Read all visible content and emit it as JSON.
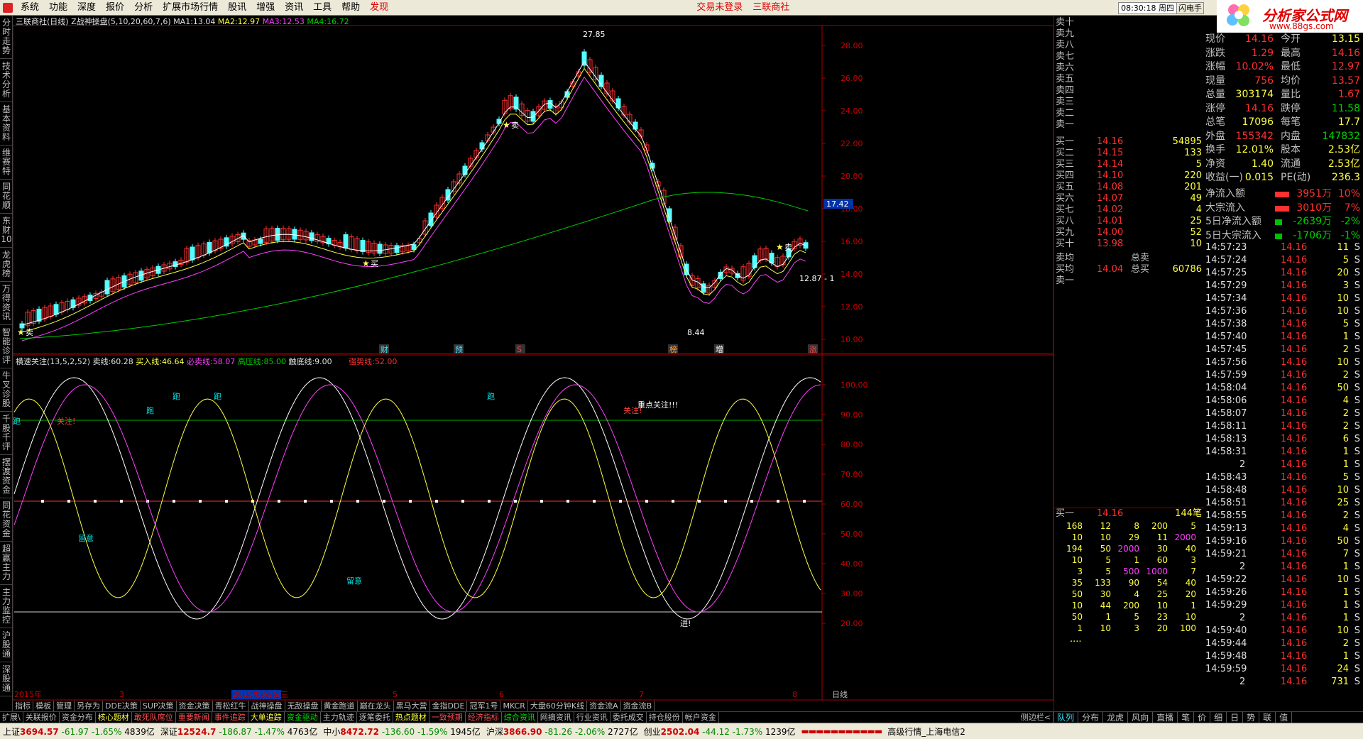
{
  "menu": {
    "items": [
      "系统",
      "功能",
      "深度",
      "报价",
      "分析",
      "扩展市场行情",
      "股讯",
      "增强",
      "资讯",
      "工具",
      "帮助"
    ],
    "alert": "发现",
    "trade_status": "交易未登录",
    "stock": "三联商社",
    "clock": "08:30:18 周四",
    "flash": "闪电手",
    "more": "行"
  },
  "brand": {
    "title": "分析家公式网",
    "url": "www.88gs.com"
  },
  "left_tabs": [
    "分时走势",
    "技术分析",
    "基本资料",
    "维赛特",
    "同花顺",
    "东财10",
    "龙虎榜",
    "万得资讯",
    "智能诊评",
    "牛叉诊股",
    "千股千评",
    "摆渡资金",
    "同花资金",
    "超赢主力",
    "主力监控",
    "沪股通",
    "深股通"
  ],
  "chart": {
    "header": {
      "stock": "三联商社(日线)",
      "indicator": "Z战神操盘(5,10,20,60,7,6)",
      "ma1_label": "MA1:",
      "ma1": "13.04",
      "ma2_label": "MA2:",
      "ma2": "12.97",
      "ma3_label": "MA3:",
      "ma3": "12.53",
      "ma4_label": "MA4:",
      "ma4": "16.72"
    },
    "price_axis": [
      "28.00",
      "26.00",
      "24.00",
      "22.00",
      "20.00",
      "18.00",
      "16.00",
      "14.00",
      "12.00",
      "10.00"
    ],
    "current_price": "17.42",
    "high_label": "27.85",
    "low_label": "8.44",
    "last_label": "12.87 - 1",
    "sell_marks": [
      "卖",
      "卖",
      "卖",
      "卖"
    ],
    "buy_mark": "买",
    "event_labels": [
      "财",
      "预",
      "S",
      "榜",
      "增",
      "涨"
    ],
    "sub_header": {
      "name": "横速关注(13,5,2,52)",
      "sell_label": "卖线:",
      "sell": "60.28",
      "buy_label": "买入线:",
      "buy": "46.64",
      "must_label": "必卖线:",
      "must": "58.07",
      "high_label": "高压线:",
      "high": "85.00",
      "bottom_label": "触底线:",
      "bottom": "9.00",
      "trend_label": "强势线:",
      "trend": "52.00"
    },
    "osc_axis": [
      "100.00",
      "90.00",
      "80.00",
      "70.00",
      "60.00",
      "50.00",
      "40.00",
      "30.00",
      "20.00"
    ],
    "osc_notes": {
      "run": "跑",
      "focus": "关注!",
      "key_focus": "重点关注!!!",
      "attention": "留意",
      "enter": "进!"
    },
    "date_labels": [
      "2015年",
      "3",
      "2015/03/25/三",
      "5",
      "6",
      "7",
      "8"
    ],
    "period": "日线"
  },
  "tab_row1": [
    "指标",
    "模板",
    "管理",
    "另存为",
    "DDE决策",
    "SUP决策",
    "资金决策",
    "青松红牛",
    "战神操盘",
    "无敌操盘",
    "黄金跑道",
    "巅在龙头",
    "黑马大营",
    "金指DDE",
    "冠军1号",
    "MKCR",
    "大盘60分钟K线",
    "资金流A",
    "资金流B"
  ],
  "tab_row2": [
    "扩展\\",
    "关联报价",
    "资金分布",
    "核心题材",
    "敢死队席位",
    "重要新闻",
    "事件追踪",
    "大单追踪",
    "资金驱动",
    "主力轨迹",
    "逐笔委托",
    "热点题材",
    "一致预期",
    "经济指标",
    "综合资讯",
    "网摘资讯",
    "行业资讯",
    "委托成交",
    "持仓股份",
    "帐户资金"
  ],
  "side_tag": "侧边栏<",
  "right_tabs": [
    "队列",
    "分布",
    "龙虎",
    "风向",
    "直播",
    "笔",
    "价",
    "细",
    "日",
    "势",
    "联",
    "值"
  ],
  "order_book": {
    "sells": [
      {
        "l": "卖十"
      },
      {
        "l": "卖九"
      },
      {
        "l": "卖八"
      },
      {
        "l": "卖七"
      },
      {
        "l": "卖六"
      },
      {
        "l": "卖五"
      },
      {
        "l": "卖四"
      },
      {
        "l": "卖三"
      },
      {
        "l": "卖二"
      },
      {
        "l": "卖一"
      }
    ],
    "buys": [
      {
        "l": "买一",
        "p": "14.16",
        "v": "54895"
      },
      {
        "l": "买二",
        "p": "14.15",
        "v": "133"
      },
      {
        "l": "买三",
        "p": "14.14",
        "v": "5"
      },
      {
        "l": "买四",
        "p": "14.10",
        "v": "220"
      },
      {
        "l": "买五",
        "p": "14.08",
        "v": "201"
      },
      {
        "l": "买六",
        "p": "14.07",
        "v": "49"
      },
      {
        "l": "买七",
        "p": "14.02",
        "v": "4"
      },
      {
        "l": "买八",
        "p": "14.01",
        "v": "25"
      },
      {
        "l": "买九",
        "p": "14.00",
        "v": "52"
      },
      {
        "l": "买十",
        "p": "13.98",
        "v": "10"
      }
    ],
    "sell_avg_label": "卖均",
    "total_sell_label": "总卖",
    "buy_avg_label": "买均",
    "buy_avg": "14.04",
    "total_buy_label": "总买",
    "total_buy": "60786",
    "sell_one_label": "卖一",
    "queue_label": "买一",
    "queue_price": "14.16",
    "queue_count": "144笔",
    "queue": [
      [
        "168",
        "12",
        "8",
        "200",
        "5"
      ],
      [
        "10",
        "10",
        "29",
        "11",
        "2000"
      ],
      [
        "194",
        "50",
        "2000",
        "30",
        "40"
      ],
      [
        "10",
        "5",
        "1",
        "60",
        "3"
      ],
      [
        "3",
        "5",
        "500",
        "1000",
        "7"
      ],
      [
        "35",
        "133",
        "90",
        "54",
        "40"
      ],
      [
        "50",
        "30",
        "4",
        "25",
        "20"
      ],
      [
        "10",
        "44",
        "200",
        "10",
        "1"
      ],
      [
        "50",
        "1",
        "5",
        "23",
        "10"
      ],
      [
        "1",
        "10",
        "3",
        "20",
        "100"
      ]
    ],
    "queue_more": "...."
  },
  "stats": [
    {
      "a": "现价",
      "av": "14.16",
      "b": "今开",
      "bv": "13.15"
    },
    {
      "a": "涨跌",
      "av": "1.29",
      "b": "最高",
      "bv": "14.16"
    },
    {
      "a": "涨幅",
      "av": "10.02%",
      "b": "最低",
      "bv": "12.97"
    },
    {
      "a": "现量",
      "av": "756",
      "b": "均价",
      "bv": "13.57"
    },
    {
      "a": "总量",
      "av": "303174",
      "b": "量比",
      "bv": "1.67"
    },
    {
      "a": "涨停",
      "av": "14.16",
      "b": "跌停",
      "bv": "11.58"
    },
    {
      "a": "总笔",
      "av": "17096",
      "b": "每笔",
      "bv": "17.7"
    },
    {
      "a": "外盘",
      "av": "155342",
      "b": "内盘",
      "bv": "147832"
    },
    {
      "a": "换手",
      "av": "12.01%",
      "b": "股本",
      "bv": "2.53亿"
    },
    {
      "a": "净资",
      "av": "1.40",
      "b": "流通",
      "bv": "2.53亿"
    },
    {
      "a": "收益(一)",
      "av": "0.015",
      "b": "PE(动)",
      "bv": "236.3"
    }
  ],
  "flows": [
    {
      "label": "净流入额",
      "value": "3951万",
      "pct": "10%"
    },
    {
      "label": "大宗流入",
      "value": "3010万",
      "pct": "7%"
    },
    {
      "label": "5日净流入额",
      "value": "-2639万",
      "pct": "-2%"
    },
    {
      "label": "5日大宗流入",
      "value": "-1706万",
      "pct": "-1%"
    }
  ],
  "ticks": [
    [
      "14:57:23",
      "14.16",
      "11",
      "S"
    ],
    [
      "14:57:24",
      "14.16",
      "5",
      "S"
    ],
    [
      "14:57:25",
      "14.16",
      "20",
      "S"
    ],
    [
      "14:57:29",
      "14.16",
      "3",
      "S"
    ],
    [
      "14:57:34",
      "14.16",
      "10",
      "S"
    ],
    [
      "14:57:36",
      "14.16",
      "10",
      "S"
    ],
    [
      "14:57:38",
      "14.16",
      "5",
      "S"
    ],
    [
      "14:57:40",
      "14.16",
      "1",
      "S"
    ],
    [
      "14:57:45",
      "14.16",
      "2",
      "S"
    ],
    [
      "14:57:56",
      "14.16",
      "10",
      "S"
    ],
    [
      "14:57:59",
      "14.16",
      "2",
      "S"
    ],
    [
      "14:58:04",
      "14.16",
      "50",
      "S"
    ],
    [
      "14:58:06",
      "14.16",
      "4",
      "S"
    ],
    [
      "14:58:07",
      "14.16",
      "2",
      "S"
    ],
    [
      "14:58:11",
      "14.16",
      "2",
      "S"
    ],
    [
      "14:58:13",
      "14.16",
      "6",
      "S"
    ],
    [
      "14:58:31",
      "14.16",
      "1",
      "S"
    ],
    [
      "",
      "2",
      "14.16",
      "1"
    ],
    [
      "14:58:43",
      "14.16",
      "5",
      "S"
    ],
    [
      "14:58:48",
      "14.16",
      "10",
      "S"
    ],
    [
      "14:58:51",
      "14.16",
      "25",
      "S"
    ],
    [
      "14:58:55",
      "14.16",
      "2",
      "S"
    ],
    [
      "14:59:13",
      "14.16",
      "4",
      "S"
    ],
    [
      "14:59:16",
      "14.16",
      "50",
      "S"
    ],
    [
      "14:59:21",
      "14.16",
      "7",
      "S"
    ],
    [
      "",
      "2",
      "14.16",
      "1"
    ],
    [
      "14:59:22",
      "14.16",
      "10",
      "S"
    ],
    [
      "14:59:26",
      "14.16",
      "1",
      "S"
    ],
    [
      "14:59:29",
      "14.16",
      "1",
      "S"
    ],
    [
      "",
      "2",
      "14.16",
      "1"
    ],
    [
      "14:59:40",
      "14.16",
      "10",
      "S"
    ],
    [
      "14:59:44",
      "14.16",
      "2",
      "S"
    ],
    [
      "14:59:48",
      "14.16",
      "1",
      "S"
    ],
    [
      "14:59:59",
      "14.16",
      "24",
      "S"
    ],
    [
      "",
      "2",
      "14.16",
      "731"
    ]
  ],
  "tick_flag": "S",
  "status": {
    "sh_label": "上证",
    "sh": "3694.57",
    "sh_chg": "-61.97",
    "sh_pct": "-1.65%",
    "sh_amt": "4839亿",
    "sz_label": "深证",
    "sz": "12524.7",
    "sz_chg": "-186.87",
    "sz_pct": "-1.47%",
    "sz_amt": "4763亿",
    "zx_label": "中小",
    "zx": "8472.72",
    "zx_chg": "-136.60",
    "zx_pct": "-1.59%",
    "zx_amt": "1945亿",
    "hs_label": "沪深",
    "hs": "3866.90",
    "hs_chg": "-81.26",
    "hs_pct": "-2.06%",
    "hs_amt": "2727亿",
    "cy_label": "创业",
    "cy": "2502.04",
    "cy_chg": "-44.12",
    "cy_pct": "-1.73%",
    "cy_amt": "1239亿",
    "feed": "高级行情_上海电信2"
  }
}
